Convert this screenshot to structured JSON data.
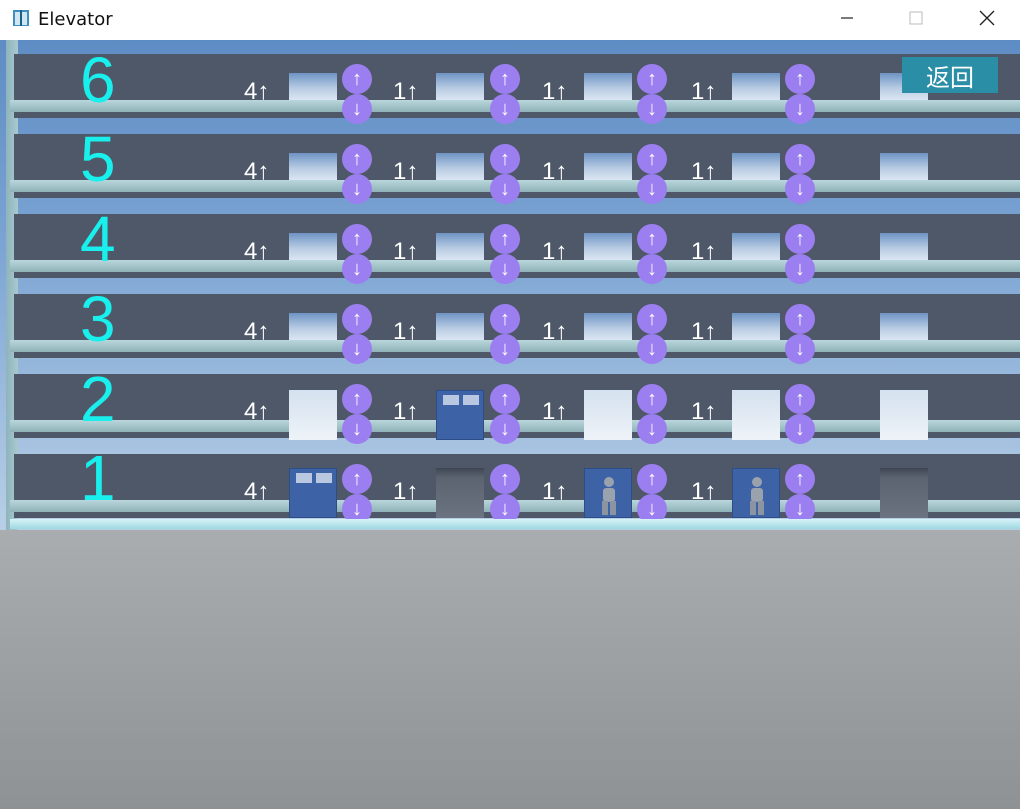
{
  "window": {
    "title": "Elevator",
    "minimize": "—",
    "maximize": "☐",
    "close": "✕"
  },
  "ui": {
    "back_label": "返回"
  },
  "floors": [
    {
      "number": "6"
    },
    {
      "number": "5"
    },
    {
      "number": "4"
    },
    {
      "number": "3"
    },
    {
      "number": "2"
    },
    {
      "number": "1"
    }
  ],
  "elevators": [
    {
      "count_label": "4↑",
      "car_floor": 1,
      "occupied": false
    },
    {
      "count_label": "1↑",
      "car_floor": 2,
      "occupied": false
    },
    {
      "count_label": "1↑",
      "car_floor": 1,
      "occupied": true
    },
    {
      "count_label": "1↑",
      "car_floor": 1,
      "occupied": true
    },
    {
      "count_label": "",
      "car_floor": null,
      "occupied": false
    }
  ],
  "call_buttons": {
    "up": "↑",
    "down": "↓"
  },
  "colors": {
    "floor_number": "#19f0ee",
    "call_button": "#9b7ff0",
    "back_button": "#2a8fa6",
    "car": "#3e62a6"
  }
}
